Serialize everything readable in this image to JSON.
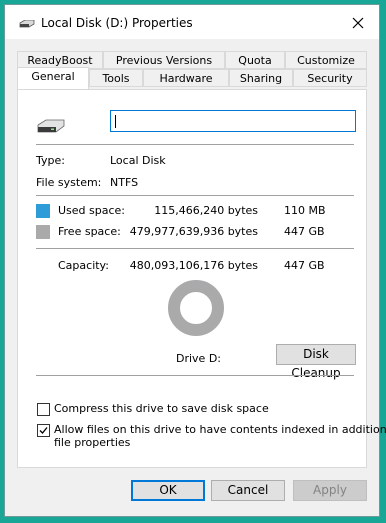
{
  "window": {
    "title": "Local Disk (D:) Properties"
  },
  "tabs": {
    "row1": [
      "ReadyBoost",
      "Previous Versions",
      "Quota",
      "Customize"
    ],
    "row2": [
      "General",
      "Tools",
      "Hardware",
      "Sharing",
      "Security"
    ],
    "active": "General"
  },
  "general": {
    "drive_label_value": "",
    "type_label": "Type:",
    "type_value": "Local Disk",
    "fs_label": "File system:",
    "fs_value": "NTFS",
    "used": {
      "label": "Used space:",
      "bytes": "115,466,240 bytes",
      "size": "110 MB",
      "color": "#2e9cd6"
    },
    "free": {
      "label": "Free space:",
      "bytes": "479,977,639,936 bytes",
      "size": "447 GB",
      "color": "#aaaaaa"
    },
    "capacity": {
      "label": "Capacity:",
      "bytes": "480,093,106,176 bytes",
      "size": "447 GB"
    },
    "used_fraction": 0.00024,
    "drive_caption": "Drive D:",
    "cleanup_button": "Disk Cleanup",
    "compress_label": "Compress this drive to save disk space",
    "compress_checked": false,
    "index_label_line1": "Allow files on this drive to have contents indexed in addition to",
    "index_label_line2": "file properties",
    "index_checked": true
  },
  "footer": {
    "ok": "OK",
    "cancel": "Cancel",
    "apply": "Apply"
  },
  "icons": {
    "close": "close-icon",
    "drive": "drive-icon",
    "check": "check-icon"
  }
}
